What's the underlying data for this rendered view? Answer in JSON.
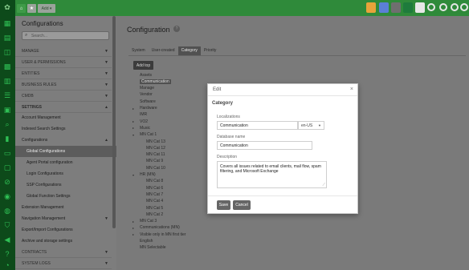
{
  "topbar": {
    "add_label": "Add ▾",
    "home_icon": "home-icon",
    "star_icon": "star-icon",
    "right_icons": [
      {
        "name": "colorful-app-icon",
        "color": "#e8a33a"
      },
      {
        "name": "flag-icon",
        "color": "#5b7fd6"
      },
      {
        "name": "theme-icon",
        "color": "#6f6f6f"
      },
      {
        "name": "excel-icon",
        "color": "#1e7b3c"
      },
      {
        "name": "mail-icon",
        "color": "#e7e7e7"
      },
      {
        "name": "headset-icon",
        "color": "#2f8a3a"
      },
      {
        "name": "settings-icon",
        "color": "#2f8a3a"
      },
      {
        "name": "power-icon",
        "color": "#2f8a3a"
      },
      {
        "name": "tag-icon",
        "color": "#2f8a3a"
      }
    ]
  },
  "sidebar": {
    "title": "Configurations",
    "search_placeholder": "Search...",
    "items": [
      {
        "label": "MANAGE",
        "type": "section"
      },
      {
        "label": "USER & PERMISSIONS",
        "type": "section"
      },
      {
        "label": "ENTITIES",
        "type": "section"
      },
      {
        "label": "BUSINESS RULES",
        "type": "section"
      },
      {
        "label": "CMDB",
        "type": "section"
      },
      {
        "label": "SETTINGS",
        "type": "section-open"
      },
      {
        "label": "Account Management",
        "type": "item"
      },
      {
        "label": "Indexed Search Settings",
        "type": "item"
      },
      {
        "label": "Configurations",
        "type": "group"
      },
      {
        "label": "Global Configurations",
        "type": "sub-active"
      },
      {
        "label": "Agent Portal configuration",
        "type": "sub"
      },
      {
        "label": "Login Configurations",
        "type": "sub"
      },
      {
        "label": "SSP Configurations",
        "type": "sub"
      },
      {
        "label": "Global Function Settings",
        "type": "sub"
      },
      {
        "label": "Extension Management",
        "type": "item"
      },
      {
        "label": "Navigation Management",
        "type": "item-chev"
      },
      {
        "label": "Export/Import Configurations",
        "type": "item"
      },
      {
        "label": "Archive and storage settings",
        "type": "item"
      },
      {
        "label": "CONTRACTS",
        "type": "section"
      },
      {
        "label": "SYSTEM LOGS",
        "type": "section"
      }
    ]
  },
  "main": {
    "title": "Configuration",
    "tabs": [
      "System",
      "User-created",
      "Category",
      "Priority"
    ],
    "active_tab": "Category",
    "add_button": "Add top",
    "tree": [
      {
        "label": "Assets",
        "toggle": ""
      },
      {
        "label": "Communication",
        "toggle": "",
        "selected": true
      },
      {
        "label": "Manage",
        "toggle": ""
      },
      {
        "label": "Vendor",
        "toggle": ""
      },
      {
        "label": "Software",
        "toggle": ""
      },
      {
        "label": "Hardware",
        "toggle": "▸"
      },
      {
        "label": "IMR",
        "toggle": ""
      },
      {
        "label": "VO2",
        "toggle": "▸"
      },
      {
        "label": "Music",
        "toggle": "▸"
      },
      {
        "label": "MN Cat 1",
        "toggle": "▾"
      },
      {
        "label": "MN Cat 13",
        "toggle": ""
      },
      {
        "label": "MN Cat 12",
        "toggle": ""
      },
      {
        "label": "MN Cat 11",
        "toggle": ""
      },
      {
        "label": "MN Cat 9",
        "toggle": ""
      },
      {
        "label": "MN Cat 10",
        "toggle": ""
      },
      {
        "label": "HR (MN)",
        "toggle": "▾"
      },
      {
        "label": "MN Cat 8",
        "toggle": ""
      },
      {
        "label": "MN Cat 6",
        "toggle": ""
      },
      {
        "label": "MN Cat 7",
        "toggle": ""
      },
      {
        "label": "MN Cat 4",
        "toggle": ""
      },
      {
        "label": "MN Cat 5",
        "toggle": ""
      },
      {
        "label": "MN Cat 2",
        "toggle": ""
      },
      {
        "label": "MN Cat 3",
        "toggle": "▸"
      },
      {
        "label": "Communications (MN)",
        "toggle": "▸"
      },
      {
        "label": "Visible only in MN first tier",
        "toggle": "▸"
      },
      {
        "label": "English",
        "toggle": ""
      },
      {
        "label": "MN Selectable",
        "toggle": ""
      }
    ]
  },
  "modal": {
    "title": "Edit",
    "close": "×",
    "section": "Category",
    "localizations_label": "Localizations",
    "localization_value": "Communication",
    "locale": "en-US",
    "db_label": "Database name",
    "db_value": "Communication",
    "desc_label": "Description",
    "desc_value": "Covers all issues related to email clients, mail flow, spam filtering, and Microsoft Exchange",
    "save": "Save",
    "cancel": "Cancel"
  }
}
